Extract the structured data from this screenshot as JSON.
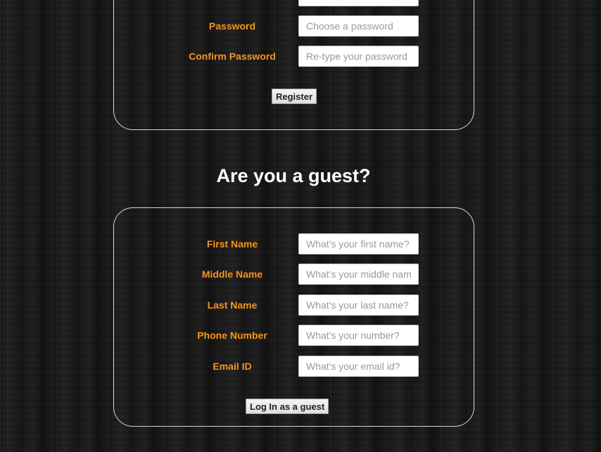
{
  "register": {
    "password_label": "Password",
    "password_placeholder": "Choose a password",
    "confirm_label": "Confirm Password",
    "confirm_placeholder": "Re-type your password",
    "submit_label": "Register"
  },
  "guest": {
    "heading": "Are you a guest?",
    "fields": [
      {
        "label": "First Name",
        "placeholder": "What's your first name?"
      },
      {
        "label": "Middle Name",
        "placeholder": "What's your middle name?"
      },
      {
        "label": "Last Name",
        "placeholder": "What's your last name?"
      },
      {
        "label": "Phone Number",
        "placeholder": "What's your number?"
      },
      {
        "label": "Email ID",
        "placeholder": "What's your email id?"
      }
    ],
    "submit_label": "Log In as a guest"
  }
}
